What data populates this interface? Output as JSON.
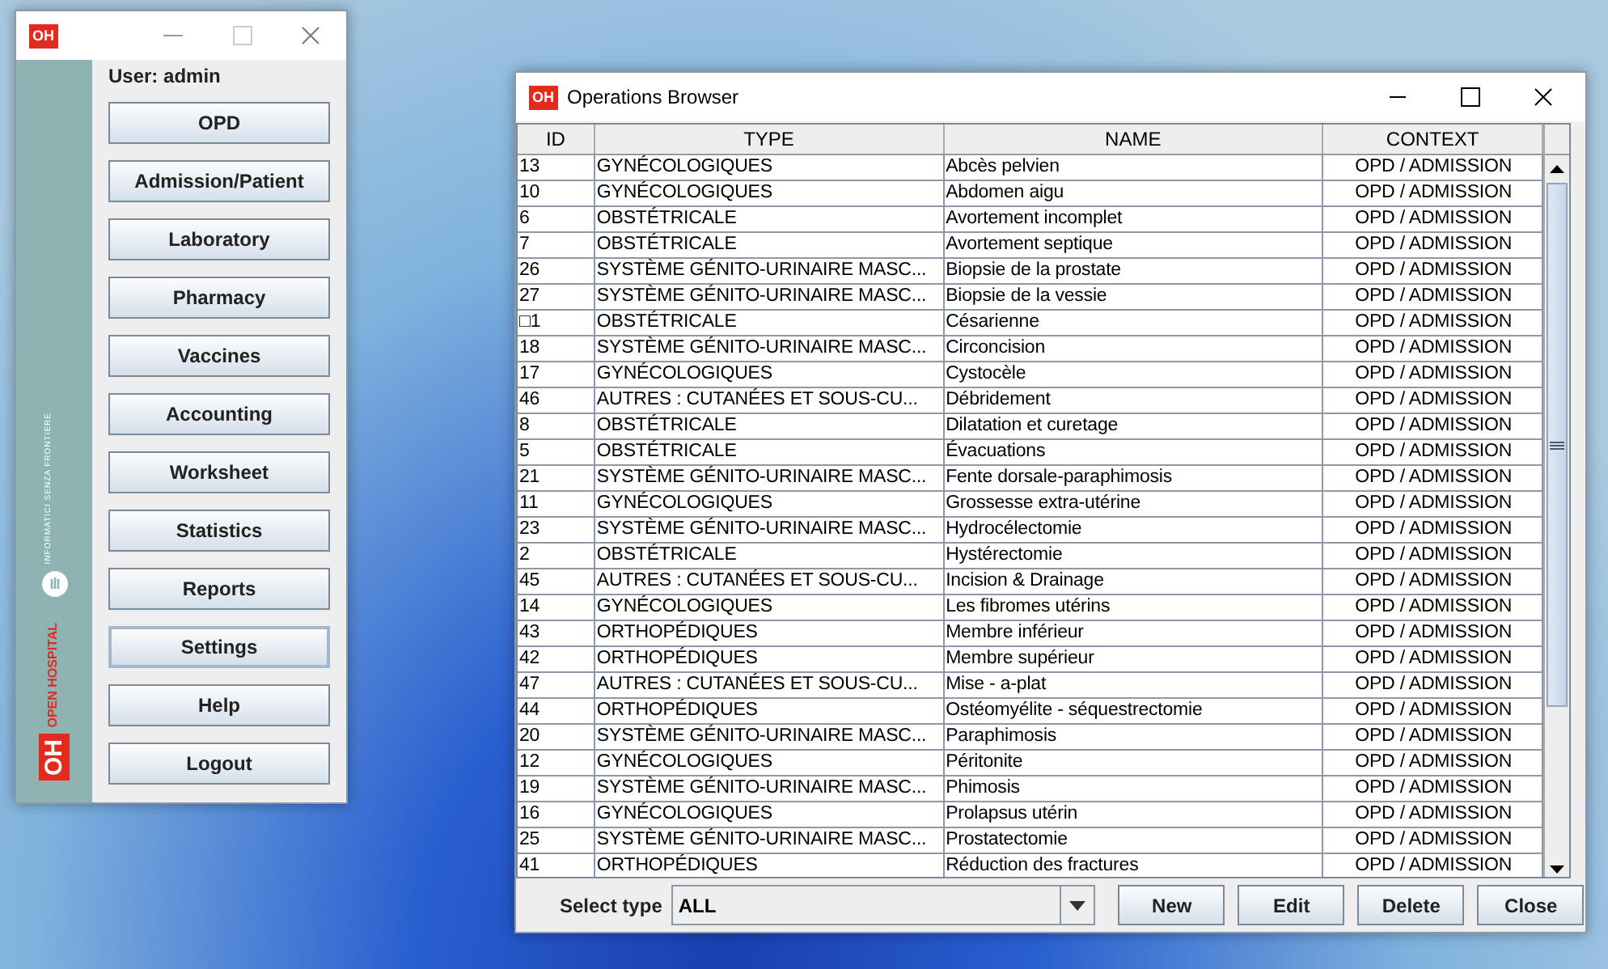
{
  "main_window": {
    "logo": "OH",
    "user_label": "User: admin",
    "sidebar_logo": {
      "org": "INFORMATICI SENZA FRONTIERE",
      "product": "OPEN HOSPITAL",
      "mark": "OH"
    },
    "buttons": [
      {
        "label": "OPD",
        "focused": false
      },
      {
        "label": "Admission/Patient",
        "focused": false
      },
      {
        "label": "Laboratory",
        "focused": false
      },
      {
        "label": "Pharmacy",
        "focused": false
      },
      {
        "label": "Vaccines",
        "focused": false
      },
      {
        "label": "Accounting",
        "focused": false
      },
      {
        "label": "Worksheet",
        "focused": false
      },
      {
        "label": "Statistics",
        "focused": false
      },
      {
        "label": "Reports",
        "focused": false
      },
      {
        "label": "Settings",
        "focused": true
      },
      {
        "label": "Help",
        "focused": false
      },
      {
        "label": "Logout",
        "focused": false
      }
    ]
  },
  "browser_window": {
    "logo": "OH",
    "title": "Operations Browser",
    "table": {
      "columns": [
        "ID",
        "TYPE",
        "NAME",
        "CONTEXT"
      ],
      "rows": [
        [
          "13",
          "GYNÉCOLOGIQUES",
          "Abcès pelvien",
          "OPD / ADMISSION"
        ],
        [
          "10",
          "GYNÉCOLOGIQUES",
          "Abdomen aigu",
          "OPD / ADMISSION"
        ],
        [
          "6",
          "OBSTÉTRICALE",
          "Avortement incomplet",
          "OPD / ADMISSION"
        ],
        [
          "7",
          "OBSTÉTRICALE",
          "Avortement septique",
          "OPD / ADMISSION"
        ],
        [
          "26",
          "SYSTÈME GÉNITO-URINAIRE MASC...",
          "Biopsie de la prostate",
          "OPD / ADMISSION"
        ],
        [
          "27",
          "SYSTÈME GÉNITO-URINAIRE MASC...",
          "Biopsie de la vessie",
          "OPD / ADMISSION"
        ],
        [
          "□1",
          "OBSTÉTRICALE",
          "Césarienne",
          "OPD / ADMISSION"
        ],
        [
          "18",
          "SYSTÈME GÉNITO-URINAIRE MASC...",
          "Circoncision",
          "OPD / ADMISSION"
        ],
        [
          "17",
          "GYNÉCOLOGIQUES",
          "Cystocèle",
          "OPD / ADMISSION"
        ],
        [
          "46",
          "AUTRES : CUTANÉES ET SOUS-CU...",
          "Débridement",
          "OPD / ADMISSION"
        ],
        [
          "8",
          "OBSTÉTRICALE",
          "Dilatation et curetage",
          "OPD / ADMISSION"
        ],
        [
          "5",
          "OBSTÉTRICALE",
          "Évacuations",
          "OPD / ADMISSION"
        ],
        [
          "21",
          "SYSTÈME GÉNITO-URINAIRE MASC...",
          "Fente dorsale-paraphimosis",
          "OPD / ADMISSION"
        ],
        [
          "11",
          "GYNÉCOLOGIQUES",
          "Grossesse extra-utérine",
          "OPD / ADMISSION"
        ],
        [
          "23",
          "SYSTÈME GÉNITO-URINAIRE MASC...",
          "Hydrocélectomie",
          "OPD / ADMISSION"
        ],
        [
          "2",
          "OBSTÉTRICALE",
          "Hystérectomie",
          "OPD / ADMISSION"
        ],
        [
          "45",
          "AUTRES : CUTANÉES ET SOUS-CU...",
          "Incision & Drainage",
          "OPD / ADMISSION"
        ],
        [
          "14",
          "GYNÉCOLOGIQUES",
          "Les fibromes utérins",
          "OPD / ADMISSION"
        ],
        [
          "43",
          "ORTHOPÉDIQUES",
          "Membre inférieur",
          "OPD / ADMISSION"
        ],
        [
          "42",
          "ORTHOPÉDIQUES",
          "Membre supérieur",
          "OPD / ADMISSION"
        ],
        [
          "47",
          "AUTRES : CUTANÉES ET SOUS-CU...",
          "Mise - a-plat",
          "OPD / ADMISSION"
        ],
        [
          "44",
          "ORTHOPÉDIQUES",
          "Ostéomyélite - séquestrectomie",
          "OPD / ADMISSION"
        ],
        [
          "20",
          "SYSTÈME GÉNITO-URINAIRE MASC...",
          "Paraphimosis",
          "OPD / ADMISSION"
        ],
        [
          "12",
          "GYNÉCOLOGIQUES",
          "Péritonite",
          "OPD / ADMISSION"
        ],
        [
          "19",
          "SYSTÈME GÉNITO-URINAIRE MASC...",
          "Phimosis",
          "OPD / ADMISSION"
        ],
        [
          "16",
          "GYNÉCOLOGIQUES",
          "Prolapsus utérin",
          "OPD / ADMISSION"
        ],
        [
          "25",
          "SYSTÈME GÉNITO-URINAIRE MASC...",
          "Prostatectomie",
          "OPD / ADMISSION"
        ],
        [
          "41",
          "ORTHOPÉDIQUES",
          "Réduction des fractures",
          "OPD / ADMISSION"
        ]
      ]
    },
    "filter": {
      "label": "Select type",
      "value": "ALL"
    },
    "buttons": [
      {
        "label": "New"
      },
      {
        "label": "Edit"
      },
      {
        "label": "Delete"
      },
      {
        "label": "Close"
      }
    ]
  }
}
